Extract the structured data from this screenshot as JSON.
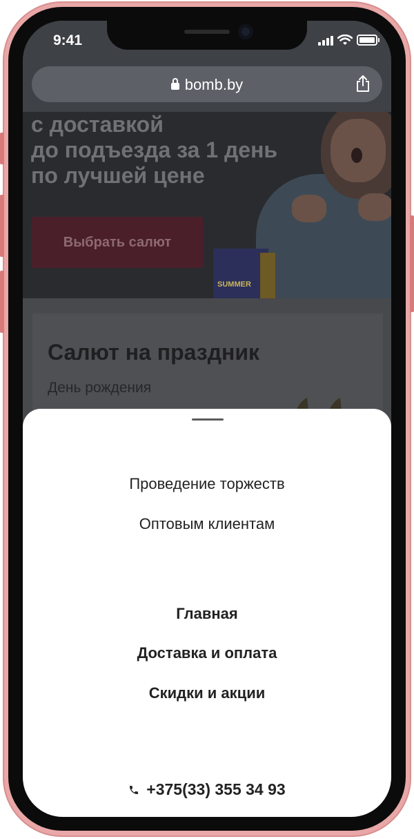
{
  "status_bar": {
    "time": "9:41",
    "icons": [
      "signal-icon",
      "wifi-icon",
      "battery-icon"
    ]
  },
  "browser": {
    "url": "bomb.by",
    "icons": [
      "lock-icon",
      "share-icon"
    ]
  },
  "hero": {
    "lines": [
      "с доставкой",
      "до подъезда за 1 день",
      "по лучшей цене"
    ],
    "cta_label": "Выбрать салют",
    "box_label": "SUMMER"
  },
  "section": {
    "title": "Салют на праздник",
    "subtitle": "День рождения"
  },
  "menu": {
    "secondary_items": [
      "Проведение торжеств",
      "Оптовым клиентам"
    ],
    "primary_items": [
      "Главная",
      "Доставка и оплата",
      "Скидки и акции"
    ],
    "phone": "+375(33) 355 34 93",
    "phone_icon": "phone-icon"
  },
  "colors": {
    "frame": "#e9a7a7",
    "overlay_cta": "#4a1f2a",
    "sheet_bg": "#ffffff",
    "text": "#222222"
  }
}
